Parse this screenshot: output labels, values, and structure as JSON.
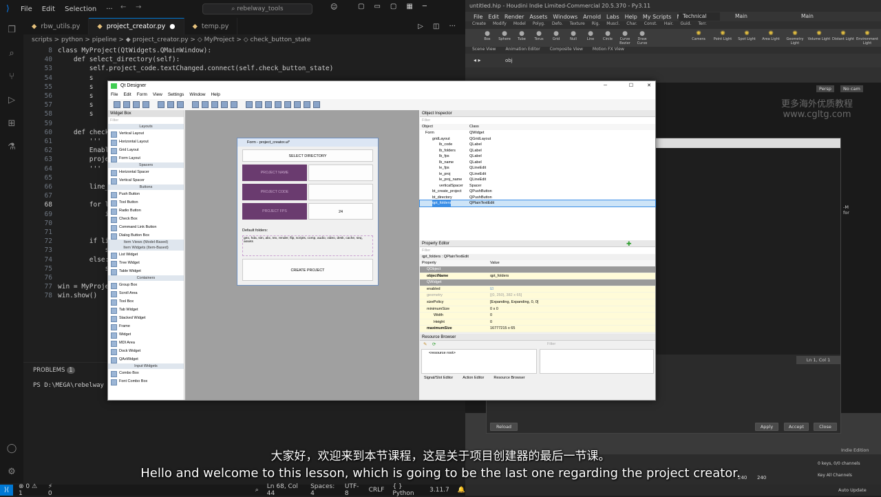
{
  "vscode": {
    "menu": [
      "File",
      "Edit",
      "Selection",
      "···"
    ],
    "search": "rebelway_tools",
    "tabs": [
      {
        "label": "rbw_utils.py"
      },
      {
        "label": "project_creator.py"
      },
      {
        "label": "temp.py"
      }
    ],
    "breadcrumb": "scripts > python > pipeline > ◆ project_creator.py > ◇ MyProject > ◇ check_button_state",
    "lines": [
      {
        "n": "8",
        "text": "class MyProject(QtWidgets.QMainWindow):"
      },
      {
        "n": "40",
        "text": "    def select_directory(self):"
      },
      {
        "n": "53",
        "text": "        self.project_code.textChanged.connect(self.check_button_state)"
      },
      {
        "n": "54",
        "text": "        s"
      },
      {
        "n": "55",
        "text": "        s"
      },
      {
        "n": "56",
        "text": "        s"
      },
      {
        "n": "57",
        "text": "        s"
      },
      {
        "n": "58",
        "text": "        s"
      },
      {
        "n": "59",
        "text": ""
      },
      {
        "n": "60",
        "text": "    def check"
      },
      {
        "n": "61",
        "text": "        '''"
      },
      {
        "n": "62",
        "text": "        Enabl"
      },
      {
        "n": "63",
        "text": "        proje"
      },
      {
        "n": "64",
        "text": "        '''"
      },
      {
        "n": "65",
        "text": ""
      },
      {
        "n": "66",
        "text": "        line_"
      },
      {
        "n": "67",
        "text": ""
      },
      {
        "n": "68",
        "text": "        for l"
      },
      {
        "n": "69",
        "text": "            i"
      },
      {
        "n": "70",
        "text": ""
      },
      {
        "n": "71",
        "text": ""
      },
      {
        "n": "72",
        "text": "        if li"
      },
      {
        "n": "73",
        "text": "            s"
      },
      {
        "n": "74",
        "text": "        else:"
      },
      {
        "n": "75",
        "text": "            s"
      },
      {
        "n": "76",
        "text": ""
      },
      {
        "n": "77",
        "text": "win = MyProje"
      },
      {
        "n": "78",
        "text": "win.show()"
      }
    ],
    "panel_tab": "PROBLEMS",
    "panel_badge": "1",
    "terminal": "PS D:\\MEGA\\rebelway",
    "status": {
      "errors": "⊗ 0 ⚠ 1",
      "ports": "⚡ 0",
      "position": "Ln 68, Col 44",
      "spaces": "Spaces: 4",
      "encoding": "UTF-8",
      "eol": "CRLF",
      "lang": "{ } Python",
      "version": "3.11.7"
    }
  },
  "qt": {
    "title": "Qt Designer",
    "menu": [
      "File",
      "Edit",
      "Form",
      "View",
      "Settings",
      "Window",
      "Help"
    ],
    "widget_box": {
      "title": "Widget Box",
      "filter": "Filter",
      "groups": [
        {
          "cat": "Layouts",
          "items": [
            "Vertical Layout",
            "Horizontal Layout",
            "Grid Layout",
            "Form Layout"
          ]
        },
        {
          "cat": "Spacers",
          "items": [
            "Horizontal Spacer",
            "Vertical Spacer"
          ]
        },
        {
          "cat": "Buttons",
          "items": [
            "Push Button",
            "Tool Button",
            "Radio Button",
            "Check Box",
            "Command Link Button",
            "Dialog Button Box"
          ]
        },
        {
          "cat": "Item Views (Model-Based)",
          "items": []
        },
        {
          "cat": "Item Widgets (Item-Based)",
          "items": [
            "List Widget",
            "Tree Widget",
            "Table Widget"
          ]
        },
        {
          "cat": "Containers",
          "items": [
            "Group Box",
            "Scroll Area",
            "Tool Box",
            "Tab Widget",
            "Stacked Widget",
            "Frame",
            "Widget",
            "MDI Area",
            "Dock Widget",
            "QAxWidget"
          ]
        },
        {
          "cat": "Input Widgets",
          "items": [
            "Combo Box",
            "Font Combo Box"
          ]
        }
      ]
    },
    "form": {
      "title": "Form - project_creator.ui*",
      "select_dir": "SELECT DIRECTORY",
      "project_name": "PROJECT NAME",
      "project_code": "PROJECT CODE",
      "project_fps": "PROJECT FPS",
      "fps_value": "24",
      "default_folders_label": "Default folders:",
      "default_folders_text": "geo, hda, sim, abc, tex, render, flip, scripts, comp, audio, video, desk, cache, seq, assets",
      "create": "CREATE PROJECT"
    },
    "object_inspector": {
      "title": "Object Inspector",
      "filter": "Filter",
      "col_object": "Object",
      "col_class": "Class",
      "rows": [
        {
          "obj": "Form",
          "cls": "QWidget",
          "indent": 0
        },
        {
          "obj": "gridLayout",
          "cls": "QGridLayout",
          "indent": 1
        },
        {
          "obj": "lb_code",
          "cls": "QLabel",
          "indent": 2
        },
        {
          "obj": "lb_folders",
          "cls": "QLabel",
          "indent": 2
        },
        {
          "obj": "lb_fps",
          "cls": "QLabel",
          "indent": 2
        },
        {
          "obj": "lb_name",
          "cls": "QLabel",
          "indent": 2
        },
        {
          "obj": "le_fps",
          "cls": "QLineEdit",
          "indent": 2
        },
        {
          "obj": "le_proj",
          "cls": "QLineEdit",
          "indent": 2
        },
        {
          "obj": "le_proj_name",
          "cls": "QLineEdit",
          "indent": 2
        },
        {
          "obj": "verticalSpacer",
          "cls": "Spacer",
          "indent": 2
        },
        {
          "obj": "bt_create_project",
          "cls": "QPushButton",
          "indent": 1
        },
        {
          "obj": "bt_directory",
          "cls": "QPushButton",
          "indent": 1
        },
        {
          "obj": "qpt_folders",
          "cls": "QPlainTextEdit",
          "indent": 1
        }
      ]
    },
    "property_editor": {
      "title": "Property Editor",
      "filter": "Filter",
      "context": "qpt_folders : QPlainTextEdit",
      "col_property": "Property",
      "col_value": "Value",
      "rows": [
        {
          "p": "QObject",
          "v": "",
          "kind": "head"
        },
        {
          "p": "objectName",
          "v": "qpt_folders",
          "kind": "bold"
        },
        {
          "p": "QWidget",
          "v": "",
          "kind": "head"
        },
        {
          "p": "enabled",
          "v": "☑",
          "kind": "normal"
        },
        {
          "p": "geometry",
          "v": "[(0, 250), 382 x 65]",
          "kind": "dim"
        },
        {
          "p": "sizePolicy",
          "v": "[Expanding, Expanding, 0, 0]",
          "kind": "normal"
        },
        {
          "p": "minimumSize",
          "v": "0 x 0",
          "kind": "normal"
        },
        {
          "p": "Width",
          "v": "0",
          "kind": "sub"
        },
        {
          "p": "Height",
          "v": "0",
          "kind": "sub"
        },
        {
          "p": "maximumSize",
          "v": "16777215 x 65",
          "kind": "bold"
        }
      ]
    },
    "resource_browser": {
      "title": "Resource Browser",
      "filter": "Filter",
      "root": "<resource root>"
    },
    "bottom_tabs": [
      "Signal/Slot Editor",
      "Action Editor",
      "Resource Browser"
    ]
  },
  "houdini": {
    "title": "untitled.hip - Houdini Indie Limited-Commercial 20.5.370 - Py3.11",
    "menu": [
      "File",
      "Edit",
      "Render",
      "Assets",
      "Windows",
      "Arnold",
      "Labs",
      "Help",
      "My Scripts",
      "My Tools"
    ],
    "desk": "Technical",
    "main": "Main",
    "shelf_tabs": [
      "Create",
      "Modify",
      "Model",
      "Polyg.",
      "Defo.",
      "Texture",
      "Rig.",
      "Muscl.",
      "Char.",
      "Const.",
      "Hair.",
      "Guid.",
      "Terr."
    ],
    "shelf_tools": [
      "Box",
      "Sphere",
      "Tube",
      "Torus",
      "Grid",
      "Null",
      "Line",
      "Circle",
      "Curve Bezier",
      "Draw Curve"
    ],
    "light_tools": [
      "Camera",
      "Point Light",
      "Spot Light",
      "Area Light",
      "Geometry Light",
      "Volume Light",
      "Distant Light",
      "Environment Light"
    ],
    "view_tabs": [
      "Scene View",
      "Animation Editor",
      "Composite View",
      "Motion FX View"
    ],
    "path": "obj",
    "persp": "Persp",
    "cam": "No cam",
    "cursor_info": "Ln 1, Col 1",
    "side_text": "-M for",
    "buttons": {
      "reload": "Reload",
      "apply": "Apply",
      "accept": "Accept",
      "close": "Close"
    },
    "edition": "Indie Edition",
    "frame1": "240",
    "frame2": "240",
    "keys": "0 keys, 0/0 channels",
    "key_all": "Key All Channels",
    "auto_update": "Auto Update"
  },
  "subtitle": {
    "cn": "大家好，欢迎来到本节课程，这是关于项目创建器的最后一节课。",
    "en": "Hello and welcome to this lesson, which is going to be the last one regarding the project creator."
  }
}
